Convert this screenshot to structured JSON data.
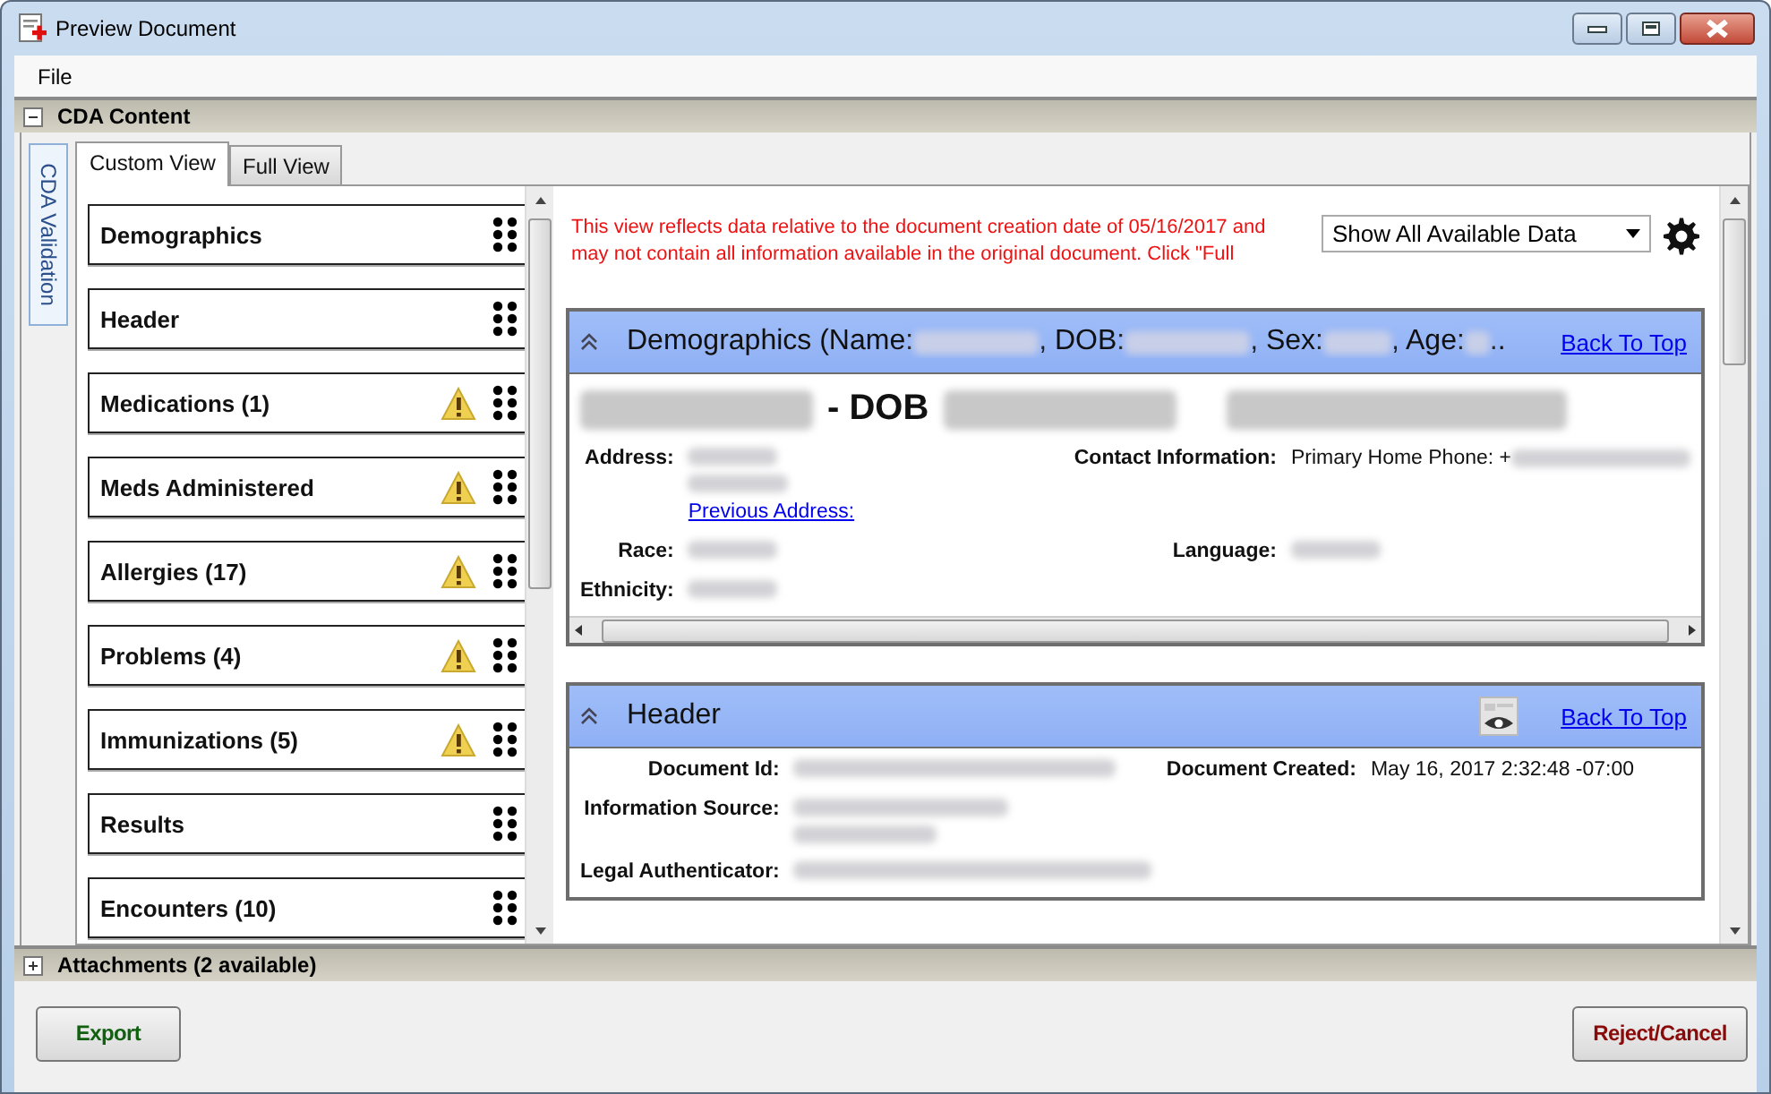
{
  "window": {
    "title": "Preview Document"
  },
  "menu": [
    "File"
  ],
  "cda_panel": {
    "title": "CDA Content",
    "expanded": true
  },
  "side_tab": {
    "label": "CDA Validation"
  },
  "tabs": [
    {
      "label": "Custom View",
      "selected": true
    },
    {
      "label": "Full View",
      "selected": false
    }
  ],
  "nav_items": [
    {
      "label": "Demographics",
      "warning": false
    },
    {
      "label": "Header",
      "warning": false
    },
    {
      "label": "Medications (1)",
      "warning": true
    },
    {
      "label": "Meds Administered",
      "warning": true
    },
    {
      "label": "Allergies (17)",
      "warning": true
    },
    {
      "label": "Problems (4)",
      "warning": true
    },
    {
      "label": "Immunizations (5)",
      "warning": true
    },
    {
      "label": "Results",
      "warning": false
    },
    {
      "label": "Encounters (10)",
      "warning": false
    }
  ],
  "notice": "This view reflects data relative to the document creation date of 05/16/2017 and may not contain all information available in the original document. Click \"Full",
  "filter": {
    "value": "Show All Available Data"
  },
  "sections": [
    {
      "kind": "demographics",
      "expanded": true,
      "back_link": "Back To Top",
      "title": [
        {
          "kind": "text",
          "text": "Demographics (Name:"
        },
        {
          "kind": "blurred"
        },
        {
          "kind": "text",
          "text": ", DOB:"
        },
        {
          "kind": "blurred"
        },
        {
          "kind": "text",
          "text": ", Sex:"
        },
        {
          "kind": "blurred"
        },
        {
          "kind": "text",
          "text": ", Age:"
        },
        {
          "kind": "blurred"
        },
        {
          "kind": "text",
          "text": ".."
        }
      ],
      "heading": [
        {
          "kind": "blurred"
        },
        {
          "kind": "text",
          "text": "- DOB"
        },
        {
          "kind": "blurred"
        },
        {
          "kind": "blurred"
        }
      ],
      "rows": [
        [
          {
            "label": "Address:",
            "value": [
              {
                "kind": "blurred"
              },
              {
                "kind": "blurred"
              },
              {
                "kind": "link",
                "text": "Previous Address:"
              }
            ]
          },
          {
            "label": "Contact Information:",
            "value": [
              {
                "kind": "text",
                "text": "Primary Home Phone: +"
              },
              {
                "kind": "blurred"
              }
            ]
          }
        ],
        [
          {
            "label": "Race:",
            "value": [
              {
                "kind": "blurred"
              }
            ]
          },
          {
            "label": "Language:",
            "value": [
              {
                "kind": "blurred"
              }
            ]
          }
        ],
        [
          {
            "label": "Ethnicity:",
            "value": [
              {
                "kind": "blurred"
              }
            ]
          }
        ]
      ]
    },
    {
      "kind": "header",
      "expanded": true,
      "back_link": "Back To Top",
      "title": [
        {
          "kind": "text",
          "text": "Header"
        }
      ],
      "rows": [
        [
          {
            "label": "Document Id:",
            "value": [
              {
                "kind": "blurred"
              }
            ]
          },
          {
            "label": "Document Created:",
            "value": [
              {
                "kind": "text",
                "text": "May 16, 2017 2:32:48 -07:00"
              }
            ]
          }
        ],
        [
          {
            "label": "Information Source:",
            "value": [
              {
                "kind": "blurred"
              },
              {
                "kind": "blurred"
              }
            ]
          }
        ],
        [
          {
            "label": "Legal Authenticator:",
            "value": [
              {
                "kind": "blurred"
              }
            ]
          }
        ]
      ]
    }
  ],
  "attachments": {
    "title": "Attachments (2 available)",
    "expanded": false
  },
  "buttons": [
    {
      "label": "Export",
      "kind": "export"
    },
    {
      "label": "Reject/Cancel",
      "kind": "cancel"
    }
  ]
}
